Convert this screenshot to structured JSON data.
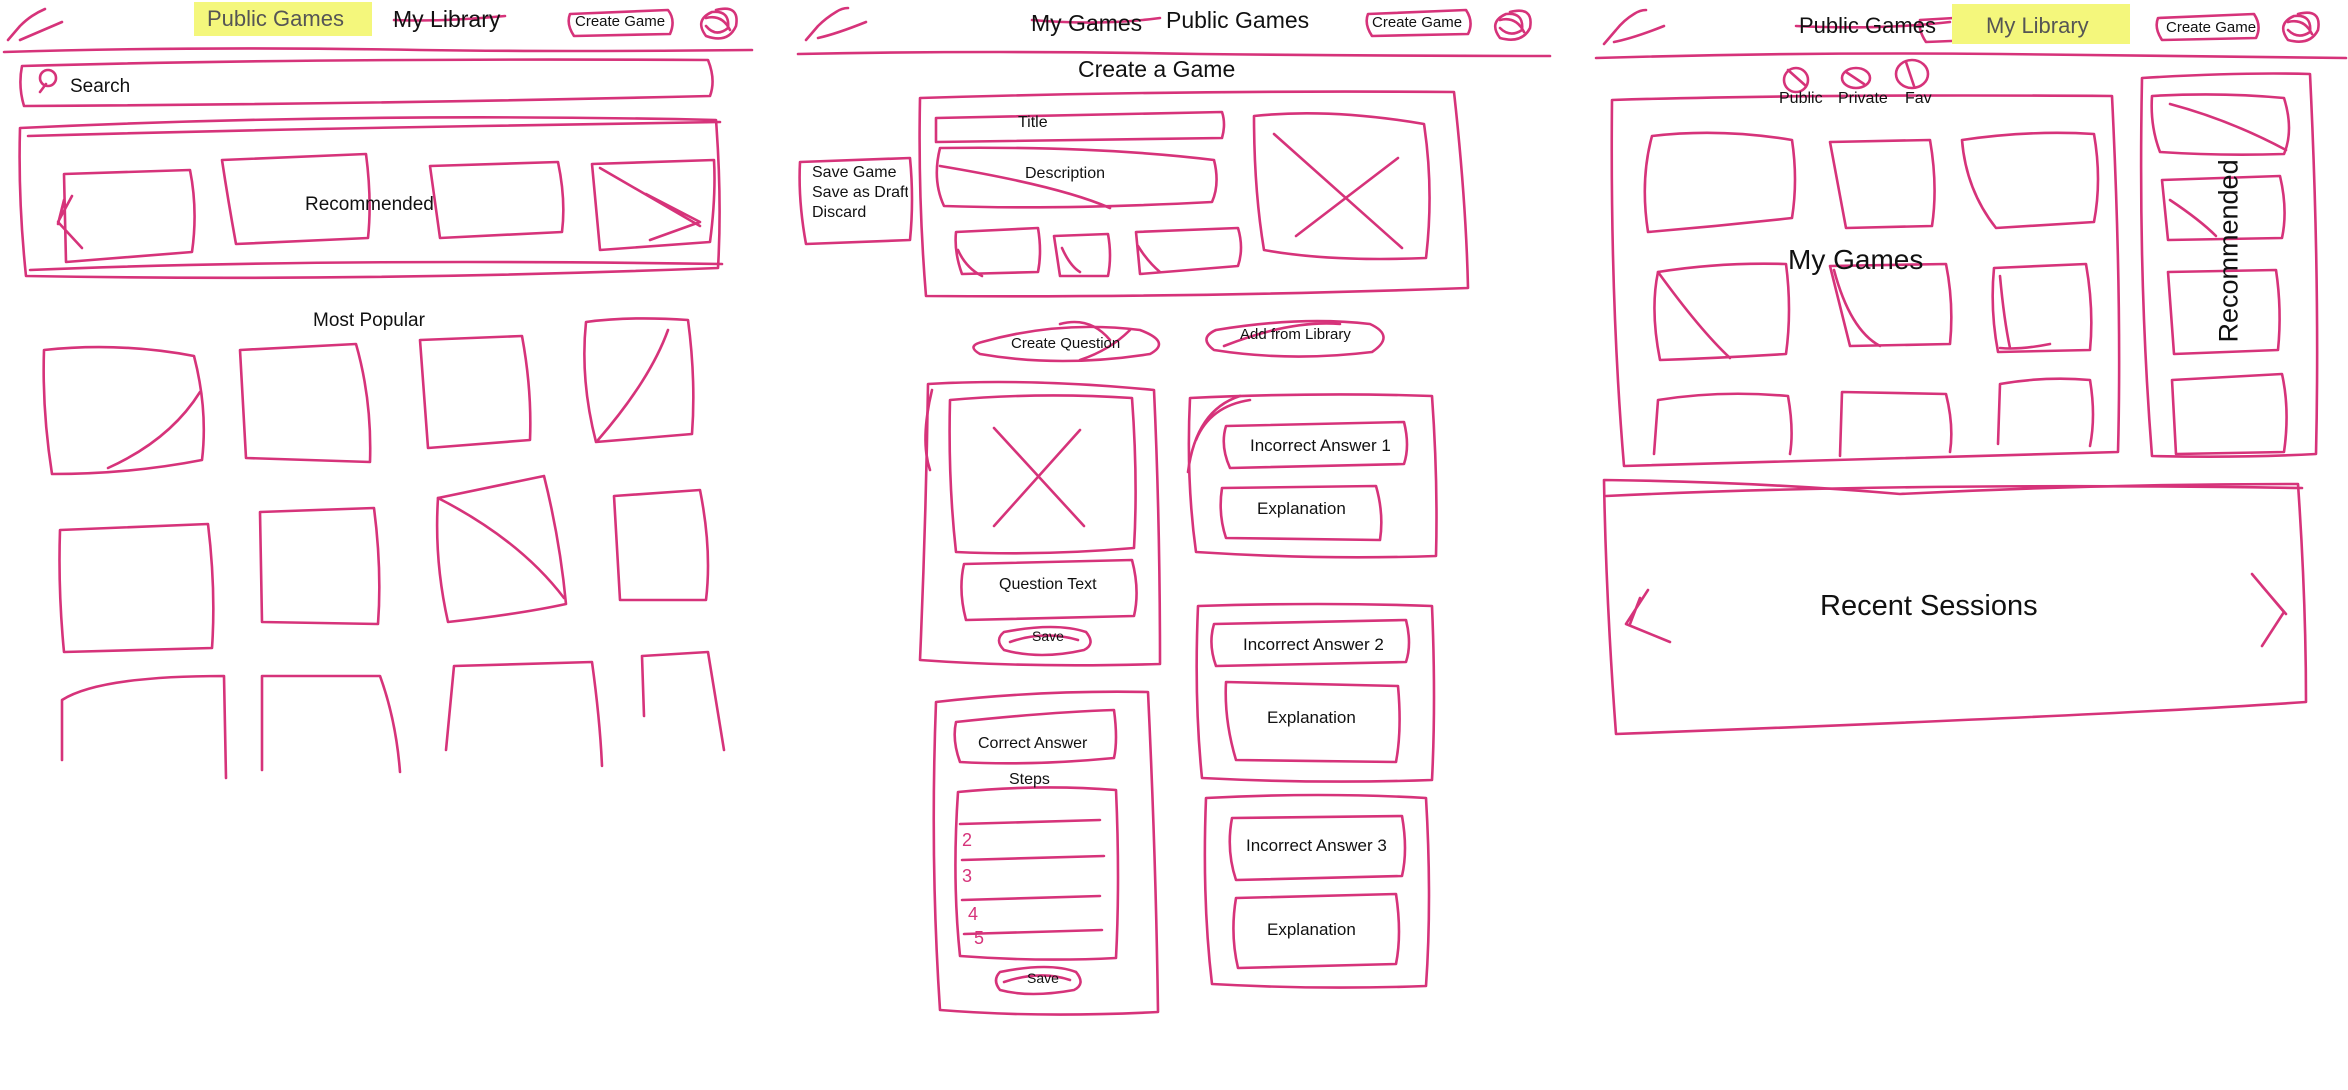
{
  "colors": {
    "ink": "#d6337a",
    "highlight": "#f4f77c",
    "text": "#111111"
  },
  "icons": {
    "logo": "pen-scribble-logo",
    "avatar": "scribbled-avatar-circle",
    "search": "magnifier-icon",
    "prev": "chevron-left-icon",
    "next": "chevron-right-icon",
    "placeholder": "x-image-placeholder"
  },
  "frame1": {
    "nav": {
      "public_games": "Public Games",
      "my_library": "My Library",
      "create_game": "Create Game",
      "active": "Public Games"
    },
    "search_label": "Search",
    "recommended_label": "Recommended",
    "most_popular_label": "Most Popular"
  },
  "frame2": {
    "nav": {
      "my_games": "My Games",
      "public_games": "Public Games",
      "create_game": "Create Game"
    },
    "title": "Create a Game",
    "menu": {
      "save_game": "Save Game",
      "save_as_draft": "Save as Draft",
      "discard": "Discard"
    },
    "form": {
      "title_label": "Title",
      "description_label": "Description"
    },
    "create_question": "Create Question",
    "add_from_library": "Add from Library",
    "question_text": "Question Text",
    "save_1": "Save",
    "correct_answer": "Correct Answer",
    "steps_label": "Steps",
    "step_numbers": [
      "2",
      "3",
      "4",
      "5"
    ],
    "save_2": "Save",
    "incorrect_1": "Incorrect Answer 1",
    "explanation_1": "Explanation",
    "incorrect_2": "Incorrect Answer 2",
    "explanation_2": "Explanation",
    "incorrect_3": "Incorrect Answer 3",
    "explanation_3": "Explanation"
  },
  "frame3": {
    "nav": {
      "public_games": "Public Games",
      "my_library": "My Library",
      "create_game": "Create Game",
      "active": "My Library"
    },
    "filters": {
      "public": "Public",
      "private": "Private",
      "fav": "Fav"
    },
    "my_games_label": "My Games",
    "recommended_label": "Recommended",
    "recent_sessions_label": "Recent Sessions"
  }
}
